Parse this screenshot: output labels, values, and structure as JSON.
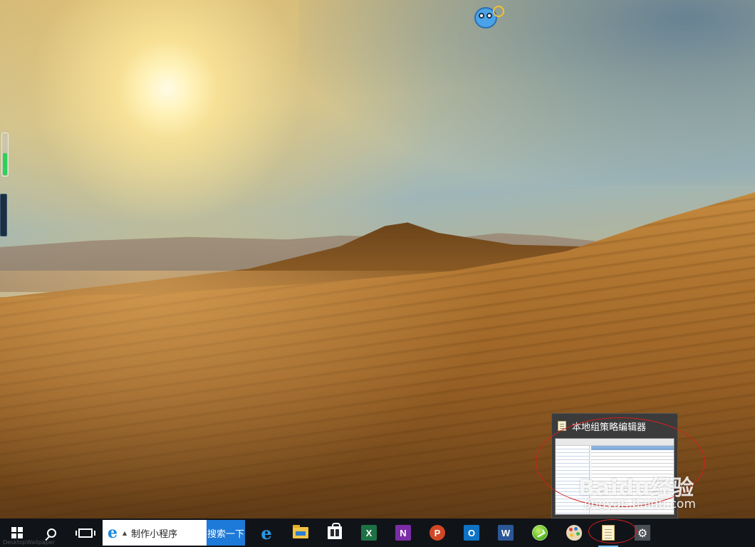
{
  "desktop": {
    "wallpaper": "desert-sunset",
    "corner_watermark": "DesktopWallpaper"
  },
  "widgets": {
    "mascot_icon": "owl-mascot-icon",
    "side_meter_level_percent": 52
  },
  "preview_popup": {
    "title": "本地组策略编辑器",
    "icon": "notepad-icon"
  },
  "watermark": {
    "brand": "Baidu经验",
    "url": "jingyan.baidu.com"
  },
  "taskbar": {
    "start_icon": "windows-logo-icon",
    "search_icon": "search-icon",
    "taskview_icon": "task-view-icon",
    "ie_search": {
      "text": "制作小程序",
      "button_label": "搜索一下"
    },
    "apps": [
      {
        "name": "Microsoft Edge",
        "icon": "edge-icon",
        "glyph": "e"
      },
      {
        "name": "File Explorer",
        "icon": "folder-icon"
      },
      {
        "name": "Microsoft Store",
        "icon": "store-icon"
      },
      {
        "name": "Excel",
        "icon": "excel-icon",
        "glyph": "X"
      },
      {
        "name": "OneNote",
        "icon": "onenote-icon",
        "glyph": "N"
      },
      {
        "name": "PowerPoint",
        "icon": "powerpoint-icon",
        "glyph": "P"
      },
      {
        "name": "Outlook",
        "icon": "outlook-icon",
        "glyph": "O"
      },
      {
        "name": "Word",
        "icon": "word-icon",
        "glyph": "W"
      },
      {
        "name": "Green App",
        "icon": "green-circle-icon"
      },
      {
        "name": "Paint",
        "icon": "paint-palette-icon"
      },
      {
        "name": "Notepad",
        "icon": "notepad-icon"
      },
      {
        "name": "Settings",
        "icon": "gear-icon",
        "glyph": "⚙"
      }
    ]
  },
  "colors": {
    "taskbar": "#101419",
    "accent": "#1e7ad8",
    "annotation": "#d71e1e"
  }
}
